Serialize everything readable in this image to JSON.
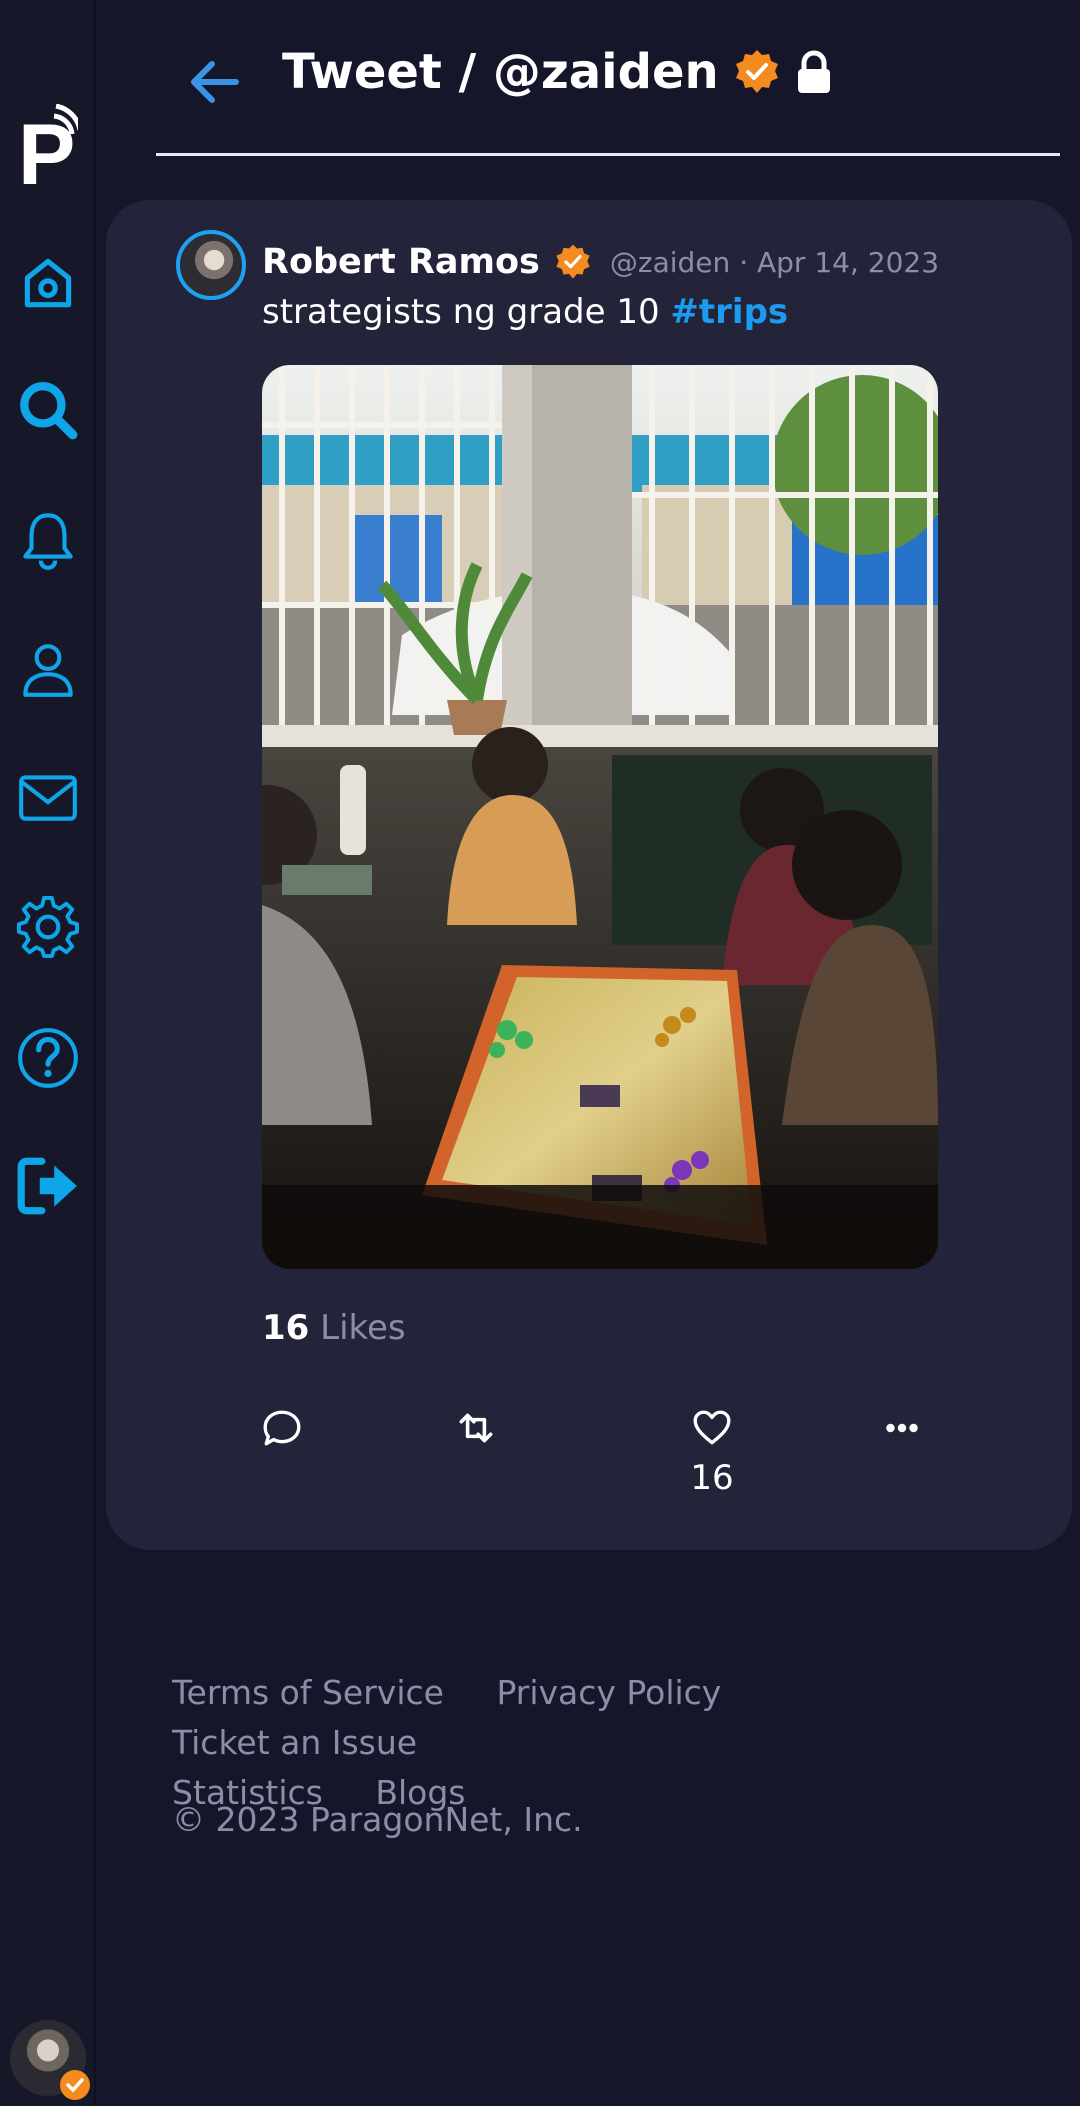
{
  "colors": {
    "background": "#151629",
    "card": "#23243a",
    "accent": "#1d9bf0",
    "icon_blue": "#0ea5e9",
    "muted_text": "#8b8ea6",
    "verified_badge": "#f58a1f"
  },
  "sidebar": {
    "logo_letter": "P",
    "items": [
      {
        "name": "home",
        "icon": "home-icon"
      },
      {
        "name": "search",
        "icon": "search-icon"
      },
      {
        "name": "notifications",
        "icon": "bell-icon"
      },
      {
        "name": "profile",
        "icon": "user-icon"
      },
      {
        "name": "messages",
        "icon": "mail-icon"
      },
      {
        "name": "settings",
        "icon": "gear-icon"
      },
      {
        "name": "help",
        "icon": "help-icon"
      },
      {
        "name": "logout",
        "icon": "logout-icon"
      }
    ]
  },
  "header": {
    "title": "Tweet / @zaiden",
    "verified": true,
    "locked": true
  },
  "tweet": {
    "author_name": "Robert Ramos",
    "author_handle": "@zaiden",
    "separator": "·",
    "date": "Apr 14, 2023",
    "text": "strategists ng grade 10",
    "hashtag": "#trips",
    "likes_count": "16",
    "likes_label": "Likes",
    "actions": {
      "reply_icon": "comment-icon",
      "retweet_icon": "retweet-icon",
      "like_icon": "heart-icon",
      "more_icon": "more-icon",
      "like_count": "16"
    }
  },
  "footer": {
    "links": [
      "Terms of Service",
      "Privacy Policy",
      "Ticket an Issue",
      "Statistics",
      "Blogs"
    ],
    "copyright": "© 2023 ParagonNet, Inc."
  }
}
